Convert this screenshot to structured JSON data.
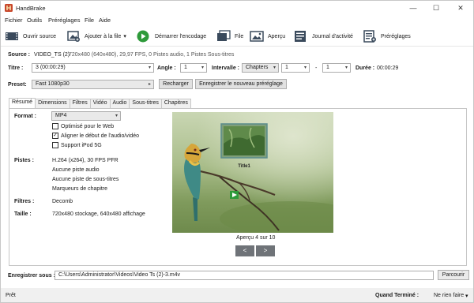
{
  "window": {
    "title": "HandBrake",
    "minimize": "—",
    "maximize": "☐",
    "close": "✕"
  },
  "menu": [
    "Fichier",
    "Outils",
    "Préréglages",
    "File",
    "Aide"
  ],
  "toolbar": {
    "open_source": "Ouvrir source",
    "add_to_queue": "Ajouter à la file",
    "add_to_queue_arrow": "▾",
    "start_encode": "Démarrer l'encodage",
    "queue": "File",
    "preview": "Aperçu",
    "activity_log": "Journal d'activité",
    "presets": "Préréglages"
  },
  "source": {
    "label": "Source :",
    "name": "VIDEO_TS (2)",
    "info": "720x480 (640x480), 29,97 FPS, 0 Pistes audio, 1 Pistes Sous-titres"
  },
  "title_row": {
    "title_label": "Titre :",
    "title_value": "3  (00:00:29)",
    "angle_label": "Angle :",
    "angle_value": "1",
    "range_label": "Intervalle :",
    "range_type": "Chapters",
    "range_start": "1",
    "range_sep": "-",
    "range_end": "1",
    "duration_label": "Durée :",
    "duration_value": "00:00:29"
  },
  "preset": {
    "label": "Preset:",
    "value": "Fast 1080p30",
    "arrow": "▸",
    "reload": "Recharger",
    "save_new": "Enregistrer le nouveau préréglage"
  },
  "tabs": [
    "Résumé",
    "Dimensions",
    "Filtres",
    "Vidéo",
    "Audio",
    "Sous-titres",
    "Chapitres"
  ],
  "summary": {
    "format_label": "Format :",
    "format_value": "MP4",
    "opt_web": "Optimisé pour le Web",
    "opt_align": "Aligner le début de l'audio/vidéo",
    "opt_ipod": "Support iPod 5G",
    "tracks_label": "Pistes :",
    "tracks": [
      "H.264 (x264), 30 FPS PFR",
      "Aucune piste audio",
      "Aucune piste de sous-titres",
      "Marqueurs de chapitre"
    ],
    "filters_label": "Filtres :",
    "filters_value": "Decomb",
    "size_label": "Taille :",
    "size_value": "720x480 stockage, 640x480 affichage"
  },
  "preview": {
    "thumb_label": "Title1",
    "caption": "Aperçu 4 sur 10",
    "prev": "<",
    "next": ">"
  },
  "save": {
    "label": "Enregistrer sous :",
    "path": "C:\\Users\\Administrator\\Videos\\Video Ts (2)-3.m4v",
    "browse": "Parcourir"
  },
  "status": {
    "left": "Prêt",
    "when_done_label": "Quand Terminé :",
    "when_done_value": "Ne rien faire",
    "when_done_arrow": "▾"
  },
  "colors": {
    "accent_green": "#2e9a3a",
    "toolbar_icon": "#3a4a5c",
    "nav_button": "#6f7378"
  },
  "icons": [
    "handbrake-logo-icon",
    "open-source-icon",
    "add-to-queue-icon",
    "play-icon",
    "queue-icon",
    "preview-icon",
    "activity-log-icon",
    "presets-icon"
  ]
}
